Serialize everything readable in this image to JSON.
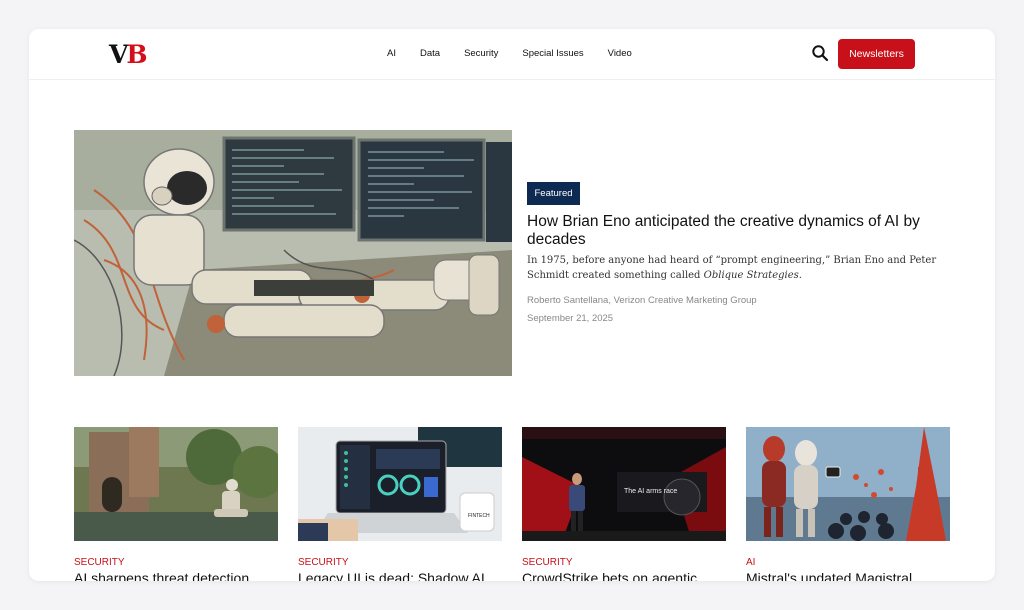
{
  "header": {
    "logo": {
      "v": "V",
      "b": "B"
    },
    "nav": [
      {
        "label": "AI"
      },
      {
        "label": "Data"
      },
      {
        "label": "Security"
      },
      {
        "label": "Special Issues"
      },
      {
        "label": "Video"
      }
    ],
    "newsletters_label": "Newsletters",
    "search_icon": "search-icon"
  },
  "featured": {
    "badge": "Featured",
    "title": "How Brian Eno anticipated the creative dynamics of AI by decades",
    "desc_before": "In 1975, before anyone had heard of “prompt engineering,” Brian Eno and Peter Schmidt created something called ",
    "desc_em": "Oblique Strategies",
    "desc_after": ".",
    "author": "Roberto Santellana, Verizon Creative Marketing Group",
    "date": "September 21, 2025"
  },
  "cards": [
    {
      "category": "SECURITY",
      "title": "AI sharpens threat detection"
    },
    {
      "category": "SECURITY",
      "title": "Legacy UI is dead: Shadow AI"
    },
    {
      "category": "SECURITY",
      "title": "CrowdStrike bets on agentic"
    },
    {
      "category": "AI",
      "title": "Mistral's updated Magistral"
    }
  ],
  "images": {
    "card3_text": "The AI arms race",
    "card2_mug_text": "FINTECH"
  },
  "colors": {
    "brand_red": "#c8101a",
    "badge_navy": "#0d2a53"
  }
}
